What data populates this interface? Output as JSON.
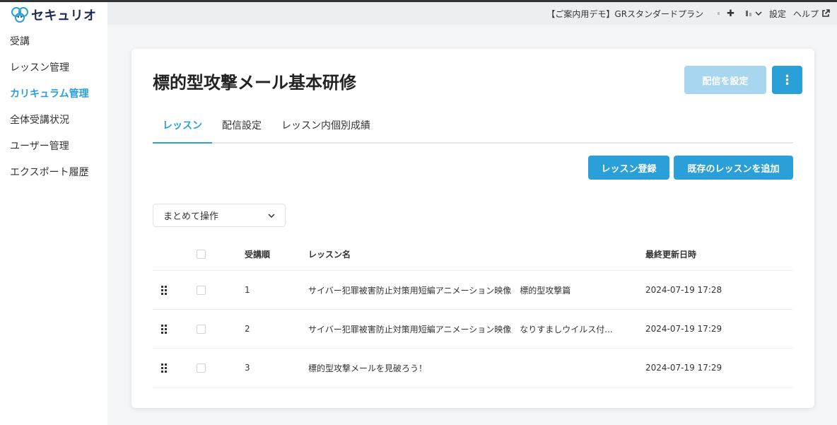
{
  "app": {
    "logo_text": "セキュリオ"
  },
  "sidebar": {
    "items": [
      {
        "label": "受講"
      },
      {
        "label": "レッスン管理"
      },
      {
        "label": "カリキュラム管理"
      },
      {
        "label": "全体受講状況"
      },
      {
        "label": "ユーザー管理"
      },
      {
        "label": "エクスポート履歴"
      }
    ]
  },
  "header": {
    "plan": "【ご案内用デモ】GRスタンダードプラン",
    "settings": "設定",
    "help": "ヘルプ"
  },
  "page": {
    "title": "標的型攻撃メール基本研修",
    "deliver_button": "配信を設定",
    "more_button": "⋮",
    "tabs": [
      {
        "label": "レッスン"
      },
      {
        "label": "配信設定"
      },
      {
        "label": "レッスン内個別成績"
      }
    ],
    "register_button": "レッスン登録",
    "add_existing_button": "既存のレッスンを追加",
    "bulk_action": "まとめて操作"
  },
  "table": {
    "headers": {
      "order": "受講順",
      "name": "レッスン名",
      "updated": "最終更新日時"
    },
    "rows": [
      {
        "order": "1",
        "name": "サイバー犯罪被害防止対策用短編アニメーション映像　標的型攻撃篇",
        "updated": "2024-07-19 17:28"
      },
      {
        "order": "2",
        "name": "サイバー犯罪被害防止対策用短編アニメーション映像　なりすましウイルス付...",
        "updated": "2024-07-19 17:29"
      },
      {
        "order": "3",
        "name": "標的型攻撃メールを見破ろう！",
        "updated": "2024-07-19 17:29"
      }
    ]
  },
  "colors": {
    "accent": "#2a9fd8",
    "accent_disabled": "#a7d6ee",
    "logo": "#1d2b53"
  },
  "icons": [
    "logo-icon",
    "plus-icon",
    "bars-icon",
    "chevron-down-icon",
    "external-link-icon",
    "kebab-icon",
    "drag-handle-icon",
    "checkbox-icon"
  ]
}
